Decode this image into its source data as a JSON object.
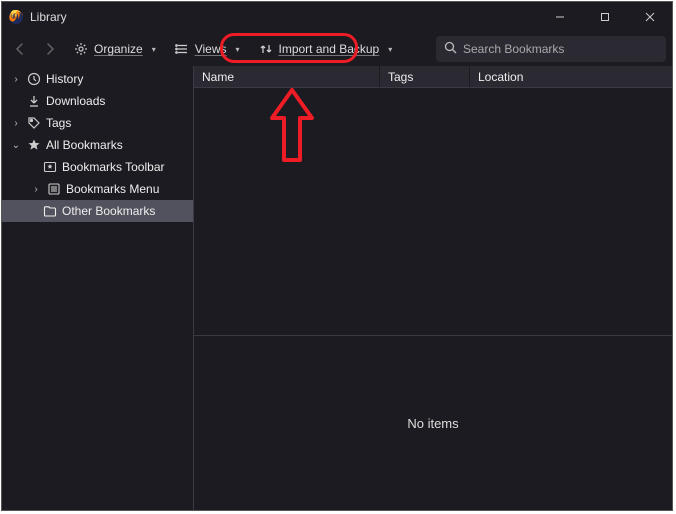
{
  "window": {
    "title": "Library"
  },
  "toolbar": {
    "organize": "Organize",
    "views": "Views",
    "import_backup": "Import and Backup"
  },
  "search": {
    "placeholder": "Search Bookmarks"
  },
  "sidebar": {
    "history": "History",
    "downloads": "Downloads",
    "tags": "Tags",
    "all_bookmarks": "All Bookmarks",
    "bookmarks_toolbar": "Bookmarks Toolbar",
    "bookmarks_menu": "Bookmarks Menu",
    "other_bookmarks": "Other Bookmarks"
  },
  "columns": {
    "name": "Name",
    "tags": "Tags",
    "location": "Location"
  },
  "details": {
    "empty": "No items"
  }
}
